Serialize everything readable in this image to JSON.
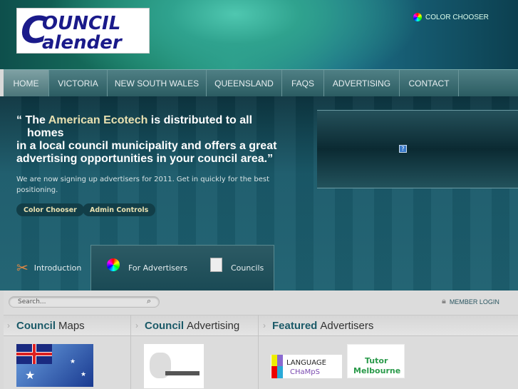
{
  "header": {
    "logo_text": "COUNCIL Calender",
    "color_chooser": "COLOR CHOOSER"
  },
  "nav": [
    {
      "label": "HOME"
    },
    {
      "label": "VICTORIA"
    },
    {
      "label": "NEW SOUTH WALES"
    },
    {
      "label": "QUEENSLAND"
    },
    {
      "label": "FAQS"
    },
    {
      "label": "ADVERTISING"
    },
    {
      "label": "CONTACT"
    }
  ],
  "hero": {
    "quote_open": "“",
    "quote_pre": "The ",
    "quote_highlight": "American Ecotech",
    "quote_post": " is distributed to all",
    "quote_line2": "homes",
    "quote_line3": "in a local council municipality and offers a great",
    "quote_line4": "advertising opportunities in your council area.",
    "quote_close": "”",
    "subtext": "We are now signing up advertisers for 2011.  Get in quickly for the best positioning.",
    "buttons": [
      "Color Chooser",
      "Admin Controls"
    ],
    "accent": "#e8e0b0"
  },
  "tabs": [
    {
      "label": "Introduction",
      "icon": "tools-icon"
    },
    {
      "label": "For Advertisers",
      "icon": "color-wheel-icon"
    },
    {
      "label": "Councils",
      "icon": "document-add-icon"
    }
  ],
  "search": {
    "placeholder": "Search..."
  },
  "member_login": "MEMBER LOGIN",
  "columns": [
    {
      "bold": "Council",
      "rest": "Maps"
    },
    {
      "bold": "Council",
      "rest": "Advertising"
    },
    {
      "bold": "Featured",
      "rest": "Advertisers"
    }
  ],
  "advertisers": {
    "language": [
      "LANGUAGE",
      "CHaMpS"
    ],
    "tutor": [
      "Tutor",
      "Melbourne"
    ]
  }
}
